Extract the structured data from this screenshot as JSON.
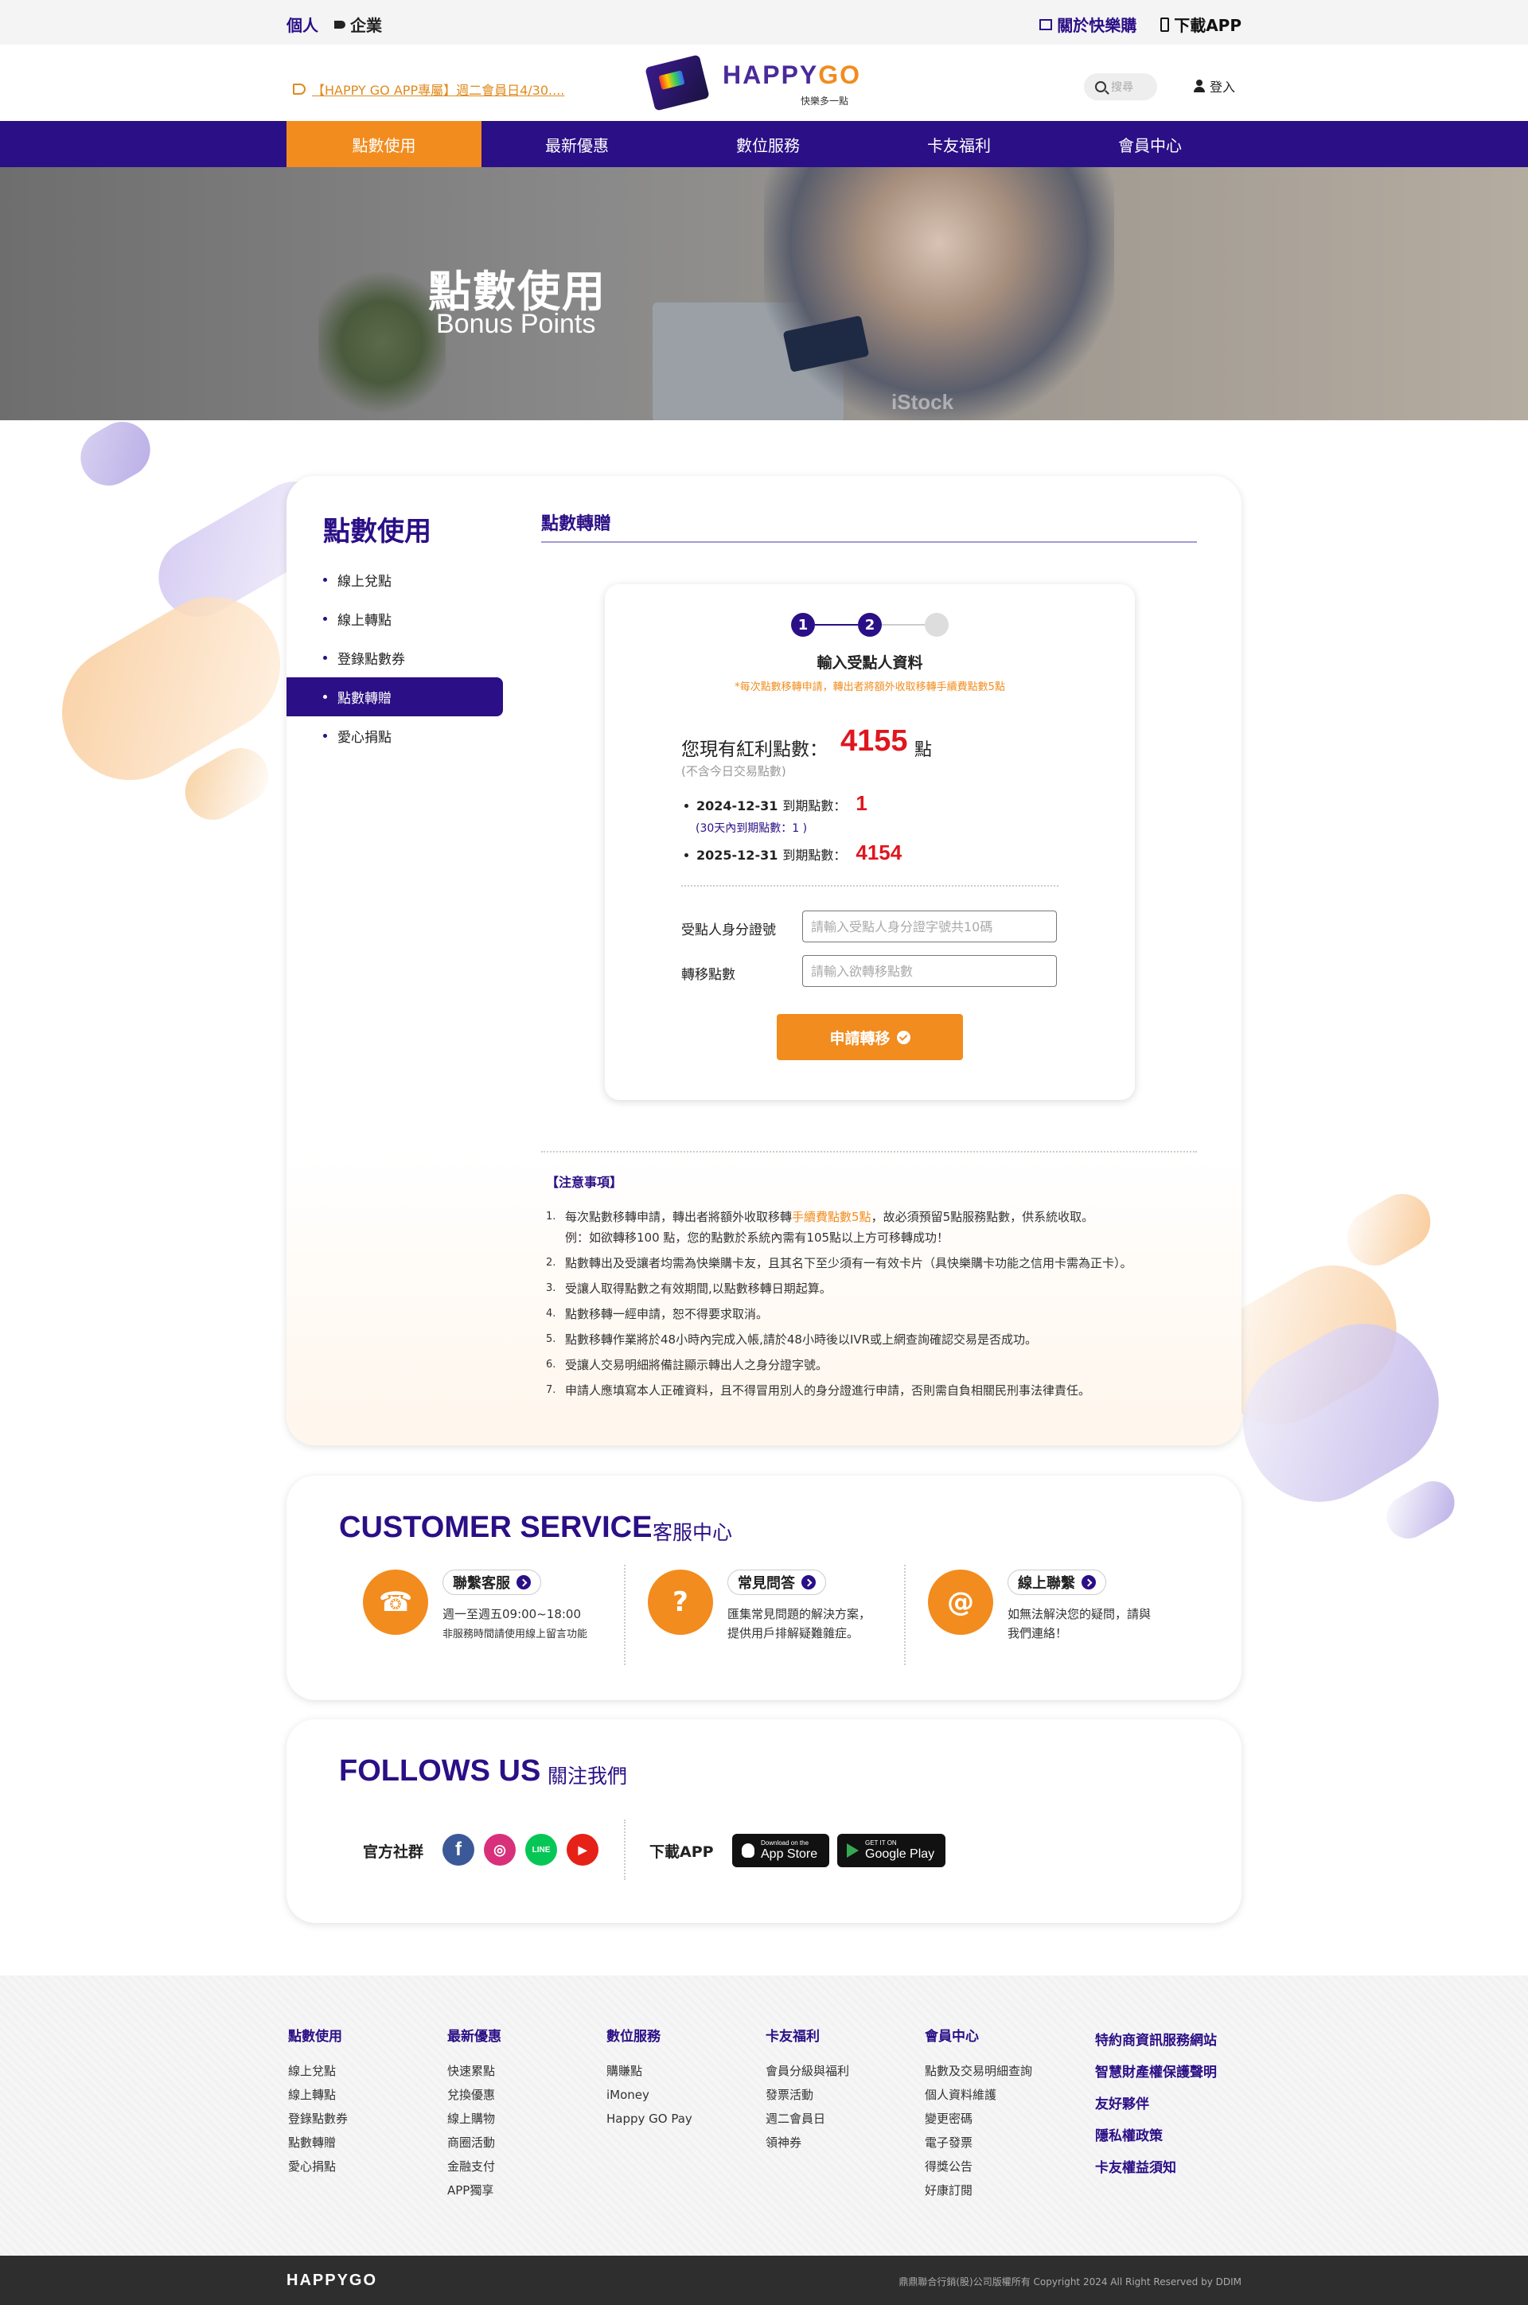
{
  "topbar": {
    "personal": "個人",
    "enterprise": "企業",
    "about": "關於快樂購",
    "download": "下載APP"
  },
  "header": {
    "marquee": "【HAPPY GO APP專屬】週二會員日4/30....",
    "logo_text_1": "HAPPY",
    "logo_text_2": "GO",
    "logo_sub": "快樂多一點",
    "logo_card_text": "HAPPYGO",
    "search_placeholder": "搜尋",
    "login": "登入"
  },
  "nav": {
    "items": [
      "點數使用",
      "最新優惠",
      "數位服務",
      "卡友福利",
      "會員中心"
    ],
    "active": "點數使用"
  },
  "hero": {
    "title": "點數使用",
    "subtitle": "Bonus Points",
    "watermark": "iStock"
  },
  "sidebar": {
    "title": "點數使用",
    "items": [
      "線上兌點",
      "線上轉點",
      "登錄點數券",
      "點數轉贈",
      "愛心捐點"
    ],
    "active": "點數轉贈"
  },
  "section": {
    "title": "點數轉贈"
  },
  "form": {
    "steps": [
      "1",
      "2"
    ],
    "heading": "輸入受點人資料",
    "note": "*每次點數移轉申請，轉出者將額外收取移轉手續費點數5點",
    "points_label": "您現有紅利點數：",
    "points_value": "4155",
    "points_unit": "點",
    "points_note": "(不含今日交易點數)",
    "expiries": [
      {
        "date": "2024-12-31",
        "label": "到期點數：",
        "value": "1"
      },
      {
        "date": "2025-12-31",
        "label": "到期點數：",
        "value": "4154"
      }
    ],
    "expiry_sub": "(30天內到期點數：1 )",
    "id_label": "受點人身分證號",
    "id_placeholder": "請輸入受點人身分證字號共10碼",
    "amount_label": "轉移點數",
    "amount_placeholder": "請輸入欲轉移點數",
    "submit": "申請轉移"
  },
  "notes": {
    "title": "【注意事項】",
    "items": [
      {
        "pre": "每次點數移轉申請，轉出者將額外收取移轉",
        "hl": "手續費點數5點",
        "post": "，故必須預留5點服務點數，供系統收取。",
        "line2": "例：如欲轉移100 點，您的點數於系統內需有105點以上方可移轉成功！"
      },
      {
        "pre": "點數轉出及受讓者均需為快樂購卡友，且其名下至少須有一有效卡片（具快樂購卡功能之信用卡需為正卡）。",
        "hl": "",
        "post": "",
        "line2": ""
      },
      {
        "pre": "受讓人取得點數之有效期間,以點數移轉日期起算。",
        "hl": "",
        "post": "",
        "line2": ""
      },
      {
        "pre": "點數移轉一經申請，恕不得要求取消。",
        "hl": "",
        "post": "",
        "line2": ""
      },
      {
        "pre": "點數移轉作業將於48小時內完成入帳,請於48小時後以IVR或上網查詢確認交易是否成功。",
        "hl": "",
        "post": "",
        "line2": ""
      },
      {
        "pre": "受讓人交易明細將備註顯示轉出人之身分證字號。",
        "hl": "",
        "post": "",
        "line2": ""
      },
      {
        "pre": "申請人應填寫本人正確資料，且不得冒用別人的身分證進行申請，否則需自負相關民刑事法律責任。",
        "hl": "",
        "post": "",
        "line2": ""
      }
    ]
  },
  "customer_service": {
    "title": "CUSTOMER SERVICE",
    "title_zh": "客服中心",
    "items": [
      {
        "icon": "phone-icon",
        "glyph": "☎",
        "button": "聯繫客服",
        "line1": "週一至週五09:00~18:00",
        "line2": "非服務時間請使用線上留言功能"
      },
      {
        "icon": "faq-icon",
        "glyph": "?",
        "button": "常見問答",
        "line1": "匯集常見問題的解決方案，",
        "line2": "提供用戶排解疑難雜症。"
      },
      {
        "icon": "mail-icon",
        "glyph": "@",
        "button": "線上聯繫",
        "line1": "如無法解決您的疑問，請與",
        "line2": "我們連絡！"
      }
    ]
  },
  "follow": {
    "title": "FOLLOWS US",
    "title_zh": "關注我們",
    "official_label": "官方社群",
    "socials": [
      {
        "name": "facebook-icon",
        "glyph": "f"
      },
      {
        "name": "instagram-icon",
        "glyph": "◎"
      },
      {
        "name": "line-icon",
        "glyph": "LINE"
      },
      {
        "name": "youtube-icon",
        "glyph": "▶"
      }
    ],
    "download_label": "下載APP",
    "app_store_small": "Download on the",
    "app_store": "App Store",
    "google_play_small": "GET IT ON",
    "google_play": "Google Play"
  },
  "footer": {
    "columns": [
      {
        "title": "點數使用",
        "items": [
          "線上兌點",
          "線上轉點",
          "登錄點數券",
          "點數轉贈",
          "愛心捐點"
        ]
      },
      {
        "title": "最新優惠",
        "items": [
          "快速累點",
          "兌換優惠",
          "線上購物",
          "商圈活動",
          "金融支付",
          "APP獨享"
        ]
      },
      {
        "title": "數位服務",
        "items": [
          "購賺點",
          "iMoney",
          "Happy GO Pay"
        ]
      },
      {
        "title": "卡友福利",
        "items": [
          "會員分級與福利",
          "發票活動",
          "週二會員日",
          "領神券"
        ]
      },
      {
        "title": "會員中心",
        "items": [
          "點數及交易明細查詢",
          "個人資料維護",
          "變更密碼",
          "電子發票",
          "得獎公告",
          "好康訂閱"
        ]
      }
    ],
    "links": [
      "特約商資訊服務網站",
      "智慧財產權保護聲明",
      "友好夥伴",
      "隱私權政策",
      "卡友權益須知"
    ],
    "brand": "HAPPYGO",
    "copyright": "鼎鼎聯合行銷(股)公司版權所有 Copyright 2024 All Right Reserved by DDIM"
  },
  "colors": {
    "brand_purple": "#2b0f86",
    "brand_orange": "#f28c1e",
    "alert_red": "#e0161e"
  }
}
